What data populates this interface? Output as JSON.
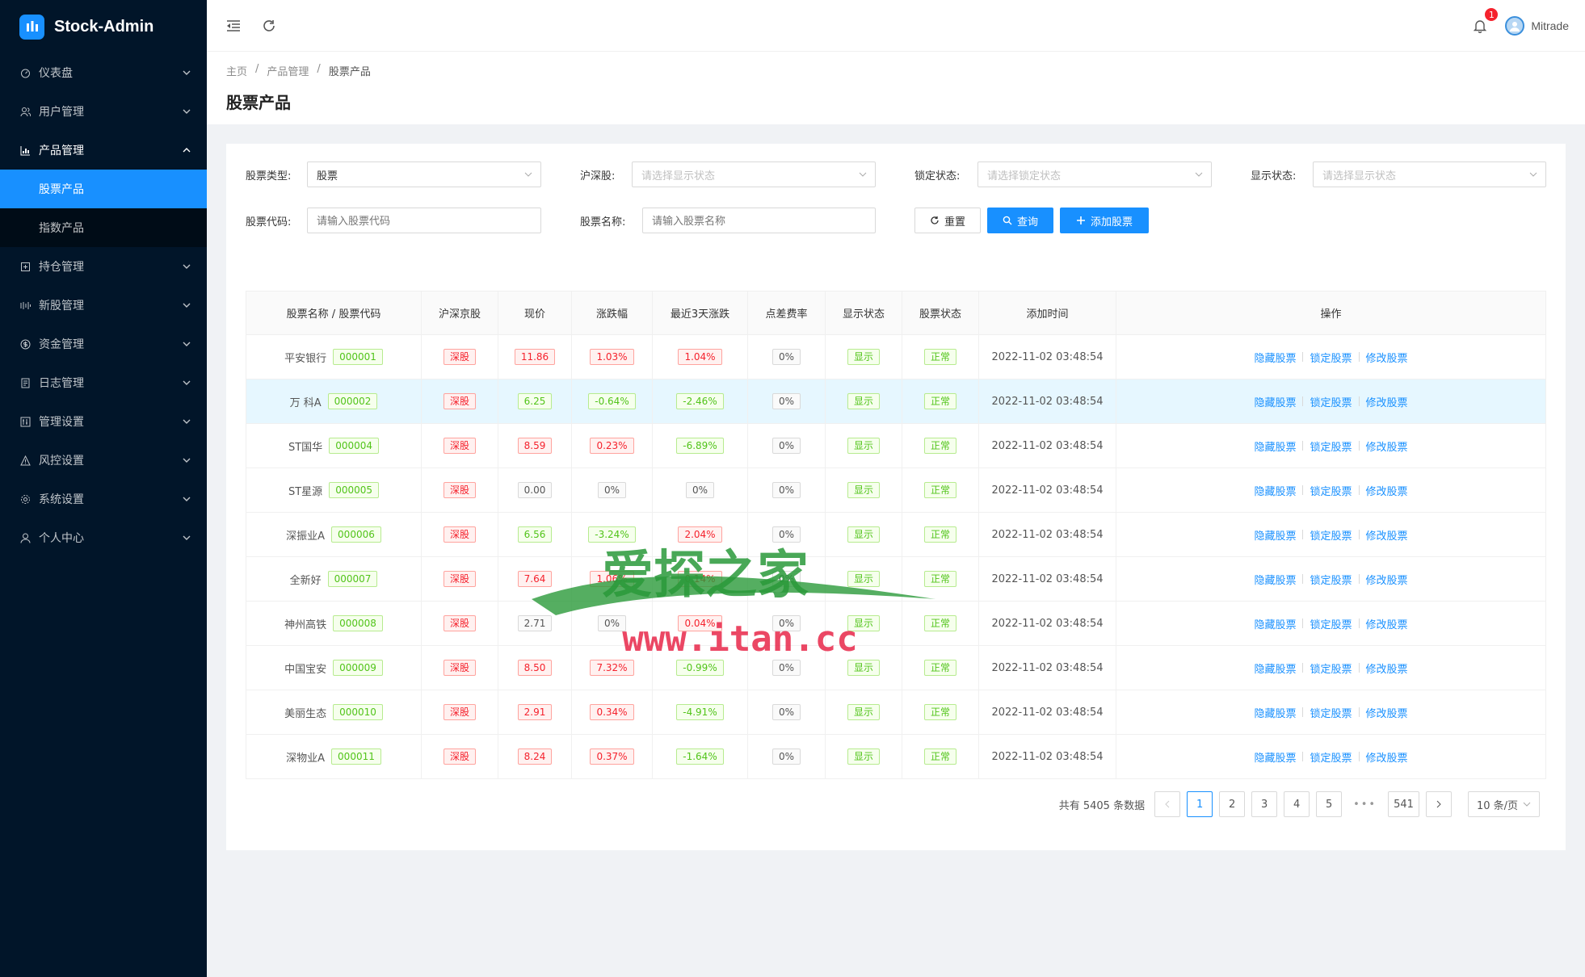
{
  "app": {
    "title": "Stock-Admin"
  },
  "sidebar": {
    "items": [
      {
        "label": "仪表盘",
        "icon": "dashboard-icon"
      },
      {
        "label": "用户管理",
        "icon": "users-icon"
      },
      {
        "label": "产品管理",
        "icon": "chart-icon",
        "children": [
          {
            "label": "股票产品",
            "active": true
          },
          {
            "label": "指数产品"
          }
        ]
      },
      {
        "label": "持仓管理",
        "icon": "position-icon"
      },
      {
        "label": "新股管理",
        "icon": "ipo-icon"
      },
      {
        "label": "资金管理",
        "icon": "money-icon"
      },
      {
        "label": "日志管理",
        "icon": "log-icon"
      },
      {
        "label": "管理设置",
        "icon": "admin-settings-icon"
      },
      {
        "label": "风控设置",
        "icon": "warning-icon"
      },
      {
        "label": "系统设置",
        "icon": "gear-icon"
      },
      {
        "label": "个人中心",
        "icon": "user-icon"
      }
    ]
  },
  "header": {
    "notification_count": "1",
    "username": "Mitrade"
  },
  "breadcrumb": [
    "主页",
    "产品管理",
    "股票产品"
  ],
  "page_title": "股票产品",
  "filters": {
    "stock_type_label": "股票类型:",
    "stock_type_value": "股票",
    "hs_label": "沪深股:",
    "hs_placeholder": "请选择显示状态",
    "lock_label": "锁定状态:",
    "lock_placeholder": "请选择锁定状态",
    "show_label": "显示状态:",
    "show_placeholder": "请选择显示状态",
    "code_label": "股票代码:",
    "code_placeholder": "请输入股票代码",
    "name_label": "股票名称:",
    "name_placeholder": "请输入股票名称",
    "reset_label": "重置",
    "query_label": "查询",
    "add_label": "添加股票"
  },
  "table": {
    "headers": [
      "股票名称 / 股票代码",
      "沪深京股",
      "现价",
      "涨跌幅",
      "最近3天涨跌",
      "点差费率",
      "显示状态",
      "股票状态",
      "添加时间",
      "操作"
    ],
    "actions": [
      "隐藏股票",
      "锁定股票",
      "修改股票"
    ],
    "rows": [
      {
        "name": "平安银行",
        "code": "000001",
        "market": "深股",
        "price": "11.86",
        "change": "1.03%",
        "change3": "1.04%",
        "spread": "0%",
        "show": "显示",
        "status": "正常",
        "time": "2022-11-02 03:48:54",
        "price_c": "red",
        "change_c": "red",
        "change3_c": "red"
      },
      {
        "name": "万 科A",
        "code": "000002",
        "market": "深股",
        "price": "6.25",
        "change": "-0.64%",
        "change3": "-2.46%",
        "spread": "0%",
        "show": "显示",
        "status": "正常",
        "time": "2022-11-02 03:48:54",
        "price_c": "green",
        "change_c": "green",
        "change3_c": "green"
      },
      {
        "name": "ST国华",
        "code": "000004",
        "market": "深股",
        "price": "8.59",
        "change": "0.23%",
        "change3": "-6.89%",
        "spread": "0%",
        "show": "显示",
        "status": "正常",
        "time": "2022-11-02 03:48:54",
        "price_c": "red",
        "change_c": "red",
        "change3_c": "green"
      },
      {
        "name": "ST星源",
        "code": "000005",
        "market": "深股",
        "price": "0.00",
        "change": "0%",
        "change3": "0%",
        "spread": "0%",
        "show": "显示",
        "status": "正常",
        "time": "2022-11-02 03:48:54",
        "price_c": "gray",
        "change_c": "gray",
        "change3_c": "gray"
      },
      {
        "name": "深振业A",
        "code": "000006",
        "market": "深股",
        "price": "6.56",
        "change": "-3.24%",
        "change3": "2.04%",
        "spread": "0%",
        "show": "显示",
        "status": "正常",
        "time": "2022-11-02 03:48:54",
        "price_c": "green",
        "change_c": "green",
        "change3_c": "red"
      },
      {
        "name": "全新好",
        "code": "000007",
        "market": "深股",
        "price": "7.64",
        "change": "1.06%",
        "change3": "0.14%",
        "spread": "0%",
        "show": "显示",
        "status": "正常",
        "time": "2022-11-02 03:48:54",
        "price_c": "red",
        "change_c": "red",
        "change3_c": "red"
      },
      {
        "name": "神州高铁",
        "code": "000008",
        "market": "深股",
        "price": "2.71",
        "change": "0%",
        "change3": "0.04%",
        "spread": "0%",
        "show": "显示",
        "status": "正常",
        "time": "2022-11-02 03:48:54",
        "price_c": "gray",
        "change_c": "gray",
        "change3_c": "red"
      },
      {
        "name": "中国宝安",
        "code": "000009",
        "market": "深股",
        "price": "8.50",
        "change": "7.32%",
        "change3": "-0.99%",
        "spread": "0%",
        "show": "显示",
        "status": "正常",
        "time": "2022-11-02 03:48:54",
        "price_c": "red",
        "change_c": "red",
        "change3_c": "green"
      },
      {
        "name": "美丽生态",
        "code": "000010",
        "market": "深股",
        "price": "2.91",
        "change": "0.34%",
        "change3": "-4.91%",
        "spread": "0%",
        "show": "显示",
        "status": "正常",
        "time": "2022-11-02 03:48:54",
        "price_c": "red",
        "change_c": "red",
        "change3_c": "green"
      },
      {
        "name": "深物业A",
        "code": "000011",
        "market": "深股",
        "price": "8.24",
        "change": "0.37%",
        "change3": "-1.64%",
        "spread": "0%",
        "show": "显示",
        "status": "正常",
        "time": "2022-11-02 03:48:54",
        "price_c": "red",
        "change_c": "red",
        "change3_c": "green"
      }
    ]
  },
  "pagination": {
    "total_text": "共有 5405 条数据",
    "pages": [
      "1",
      "2",
      "3",
      "4",
      "5"
    ],
    "ellipsis": "•••",
    "last_page": "541",
    "page_size": "10 条/页",
    "current": "1"
  },
  "watermark": {
    "text_cn": "爱探之家",
    "text_url": "www.itan.cc"
  },
  "colors": {
    "sidebar_bg": "#011529",
    "primary": "#1890ff",
    "up_red": "#f5222d",
    "down_green": "#52c41a"
  }
}
